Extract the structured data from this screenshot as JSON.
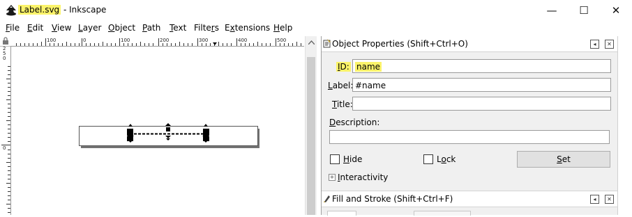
{
  "titlebar": {
    "filename": "Label.svg",
    "separator": " - ",
    "app_name": "Inkscape",
    "minimize_glyph": "—",
    "maximize_glyph": "☐",
    "close_glyph": "✕"
  },
  "menu": [
    {
      "accel": "F",
      "rest": "ile"
    },
    {
      "accel": "E",
      "rest": "dit"
    },
    {
      "accel": "V",
      "rest": "iew"
    },
    {
      "accel": "L",
      "rest": "ayer"
    },
    {
      "accel": "O",
      "rest": "bject"
    },
    {
      "accel": "P",
      "rest": "ath"
    },
    {
      "accel": "T",
      "rest": "ext"
    },
    {
      "pre": "Filte",
      "accel": "r",
      "rest": "s"
    },
    {
      "pre": "E",
      "accel": "x",
      "rest": "tensions"
    },
    {
      "accel": "H",
      "rest": "elp"
    }
  ],
  "ruler": {
    "h_labels": [
      "100",
      "0",
      "100",
      "200",
      "300",
      "400",
      "500"
    ],
    "v_top_label": "250",
    "v_mid_label": "0"
  },
  "object_properties": {
    "title": "Object Properties (Shift+Ctrl+O)",
    "id_label_accel": "I",
    "id_label_rest": "D:",
    "id_value": "name",
    "label_label_accel": "L",
    "label_label_rest": "abel:",
    "label_value": "#name",
    "title_label_accel": "T",
    "title_label_rest": "itle:",
    "title_value": "",
    "description_label_accel": "D",
    "description_label_rest": "escription:",
    "description_value": "",
    "hide_accel": "H",
    "hide_rest": "ide",
    "hide_checked": false,
    "lock_pre": "L",
    "lock_accel": "o",
    "lock_rest": "ck",
    "lock_checked": false,
    "set_accel": "S",
    "set_rest": "et",
    "interactivity_accel": "I",
    "interactivity_rest": "nteractivity",
    "collapse_glyph": "◂",
    "close_glyph": "✕"
  },
  "fill_stroke": {
    "title": "Fill and Stroke (Shift+Ctrl+F)"
  },
  "colors": {
    "highlight": "#fbf36a",
    "dock_bg": "#f0f0f0",
    "button_bg": "#e1e1e1"
  }
}
